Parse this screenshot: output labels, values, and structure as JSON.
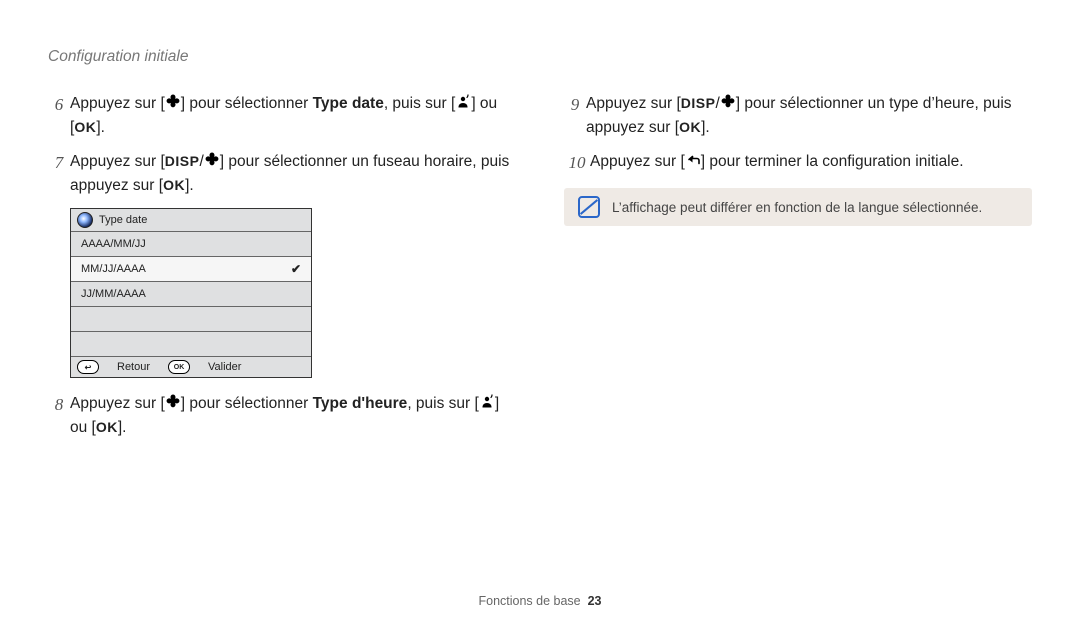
{
  "section_title": "Configuration initiale",
  "steps_left": {
    "s6": {
      "num": "6",
      "pre": "Appuyez sur [",
      "mid1": "] pour sélectionner ",
      "bold": "Type date",
      "mid2": ", puis sur [",
      "mid3": "] ou [",
      "post": "]."
    },
    "s7": {
      "num": "7",
      "pre": "Appuyez sur [",
      "mid1": "/",
      "mid2": "] pour sélectionner un fuseau horaire, puis appuyez sur [",
      "post": "]."
    },
    "s8": {
      "num": "8",
      "pre": "Appuyez sur [",
      "mid1": "] pour sélectionner ",
      "bold": "Type d'heure",
      "mid2": ", puis sur [",
      "mid3": "] ou [",
      "post": "]."
    }
  },
  "steps_right": {
    "s9": {
      "num": "9",
      "pre": "Appuyez sur [",
      "mid1": "/",
      "mid2": "] pour sélectionner un type d’heure, puis appuyez sur [",
      "post": "]."
    },
    "s10": {
      "num": "10",
      "pre": "Appuyez sur [",
      "mid": "] pour terminer la configuration initiale."
    }
  },
  "ui": {
    "title": "Type date",
    "options": [
      "AAAA/MM/JJ",
      "MM/JJ/AAAA",
      "JJ/MM/AAAA"
    ],
    "selected_index": 1,
    "footer_back_key": "↩",
    "footer_back_label": "Retour",
    "footer_ok_key": "OK",
    "footer_ok_label": "Valider"
  },
  "icons": {
    "disp": "DISP",
    "ok": "OK"
  },
  "note": "L’affichage peut différer en fonction de la langue sélectionnée.",
  "footer": {
    "label": "Fonctions de base",
    "page": "23"
  }
}
